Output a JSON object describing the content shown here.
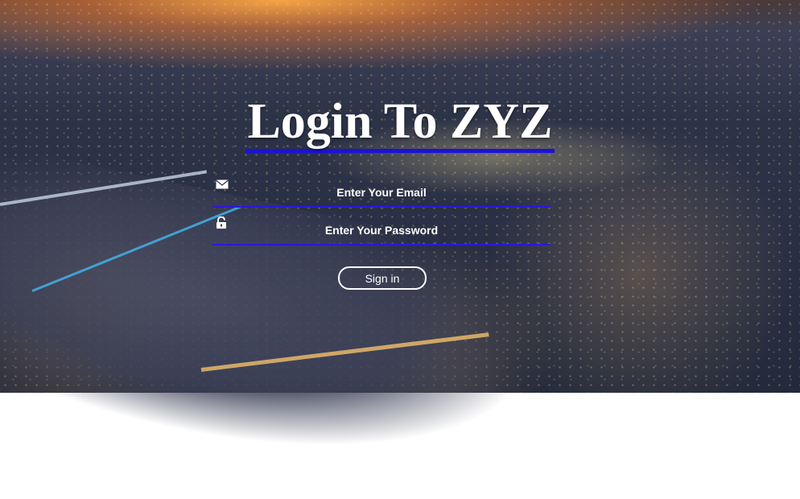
{
  "page": {
    "title": "Login To ZYZ"
  },
  "form": {
    "email": {
      "placeholder": "Enter Your Email",
      "value": "",
      "icon": "envelope-icon"
    },
    "password": {
      "placeholder": "Enter Your Password",
      "value": "",
      "icon": "unlock-icon"
    },
    "submit_label": "Sign in"
  },
  "colors": {
    "accent_underline": "#1b12d8",
    "text": "#ffffff"
  }
}
